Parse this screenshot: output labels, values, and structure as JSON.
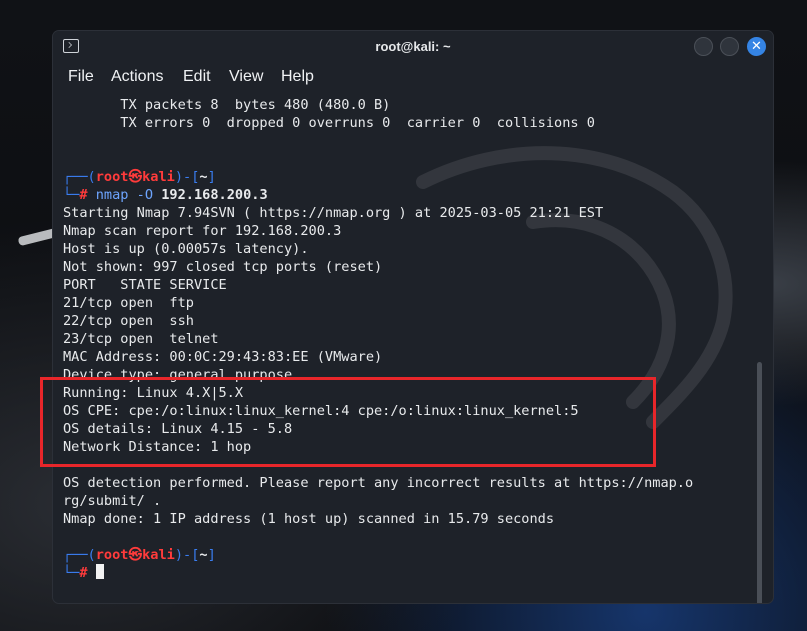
{
  "window": {
    "title": "root@kali: ~",
    "close_glyph": "✕"
  },
  "menu": {
    "file": "File",
    "actions": "Actions",
    "edit": "Edit",
    "view": "View",
    "help": "Help"
  },
  "terminal": {
    "output_top": [
      "       TX packets 8  bytes 480 (480.0 B)",
      "       TX errors 0  dropped 0 overruns 0  carrier 0  collisions 0"
    ],
    "prompt": {
      "corner_top": "┌──(",
      "user": "root㉿kali",
      "sep": ")-[",
      "dir": "~",
      "close": "]",
      "corner_bottom": "└─",
      "hash": "#"
    },
    "command": {
      "name": "nmap",
      "flag": " -O ",
      "target": "192.168.200.3"
    },
    "nmap_output": [
      "Starting Nmap 7.94SVN ( https://nmap.org ) at 2025-03-05 21:21 EST",
      "Nmap scan report for 192.168.200.3",
      "Host is up (0.00057s latency).",
      "Not shown: 997 closed tcp ports (reset)",
      "PORT   STATE SERVICE",
      "21/tcp open  ftp",
      "22/tcp open  ssh",
      "23/tcp open  telnet",
      "MAC Address: 00:0C:29:43:83:EE (VMware)",
      "Device type: general purpose",
      "Running: Linux 4.X|5.X",
      "OS CPE: cpe:/o:linux:linux_kernel:4 cpe:/o:linux:linux_kernel:5",
      "OS details: Linux 4.15 - 5.8",
      "Network Distance: 1 hop",
      "",
      "OS detection performed. Please report any incorrect results at https://nmap.o",
      "rg/submit/ .",
      "Nmap done: 1 IP address (1 host up) scanned in 15.79 seconds"
    ]
  },
  "colors": {
    "terminal_bg": "#1e2229",
    "prompt_user": "#ff3b3b",
    "prompt_decor": "#3a7df0",
    "highlight_box": "#e8262a",
    "close_button": "#3584e4"
  }
}
